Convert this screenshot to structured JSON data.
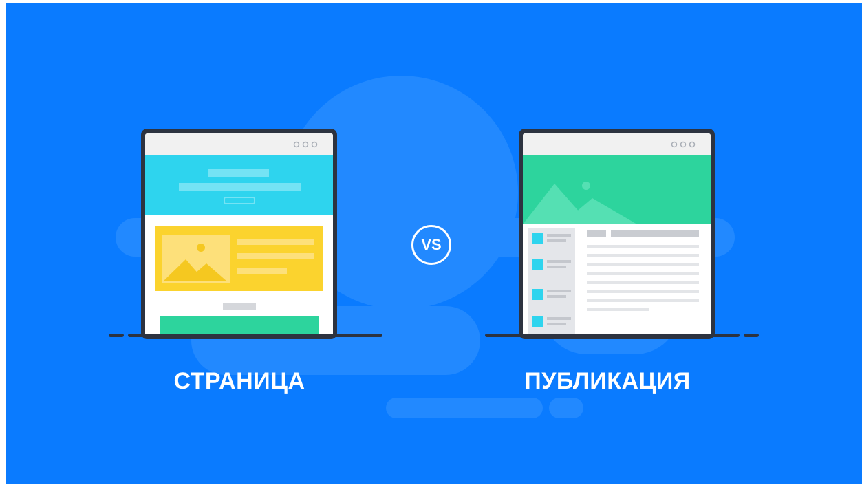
{
  "left_label": "СТРАНИЦА",
  "right_label": "ПУБЛИКАЦИЯ",
  "vs_label": "VS",
  "colors": {
    "background": "#0a7bff",
    "cyan_header": "#2ed4ee",
    "yellow_block": "#fbd32e",
    "green": "#2dd49d",
    "device_frame": "#2d3340"
  },
  "icons": [
    "browser-dots-icon",
    "image-placeholder-icon",
    "landscape-icon"
  ]
}
